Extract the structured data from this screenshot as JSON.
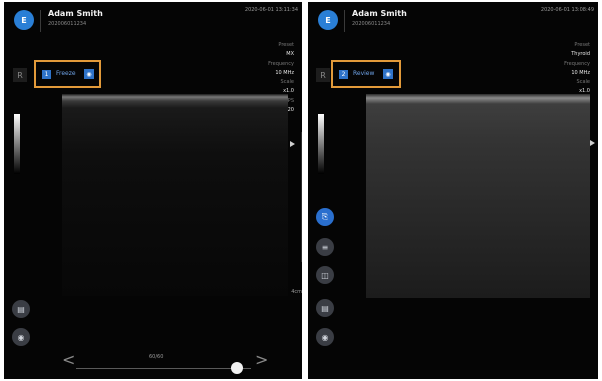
{
  "left_panel": {
    "patient_name": "Adam Smith",
    "patient_id": "202006011234",
    "datetime": "2020-06-01 13:11:34",
    "logo_text": "E",
    "r_badge": "R",
    "image_number": "1",
    "mode_label": "Freeze",
    "lock_icon": "lock-icon",
    "params": [
      {
        "label": "Preset",
        "value": "MX"
      },
      {
        "label": "Frequency",
        "value": "10 MHz"
      },
      {
        "label": "Scale",
        "value": "x1.0"
      },
      {
        "label": "FPS",
        "value": "20"
      }
    ],
    "bottom_buttons": [
      "calipers-icon",
      "camera-icon"
    ],
    "frame_counter": "60/60",
    "prev_glyph": "<",
    "next_glyph": ">",
    "cine_position": 1.0
  },
  "right_panel": {
    "patient_name": "Adam Smith",
    "patient_id": "202006011234",
    "datetime": "2020-06-01 13:08:49",
    "logo_text": "E",
    "r_badge": "R",
    "image_number": "2",
    "mode_label": "Review",
    "lock_icon": "lock-icon",
    "params": [
      {
        "label": "Preset",
        "value": "Thyroid"
      },
      {
        "label": "Frequency",
        "value": "10 MHz"
      },
      {
        "label": "Scale",
        "value": "x1.0"
      }
    ],
    "side_buttons": [
      "export-icon",
      "menu-icon",
      "split-view-icon",
      "calipers-icon",
      "camera-icon"
    ],
    "depth_label": "4cm"
  },
  "colors": {
    "accent": "#2f73c8",
    "highlight": "#e29a3a",
    "background": "#050505"
  }
}
